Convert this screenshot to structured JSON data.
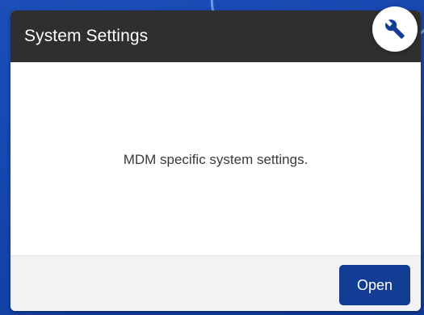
{
  "card": {
    "title": "System Settings",
    "description": "MDM specific system settings.",
    "open_label": "Open",
    "icon": "wrench-icon"
  },
  "colors": {
    "header_bg": "#2f2f30",
    "button_bg": "#133c95",
    "icon_color": "#133c95",
    "desktop_bg": "#1545ad"
  }
}
